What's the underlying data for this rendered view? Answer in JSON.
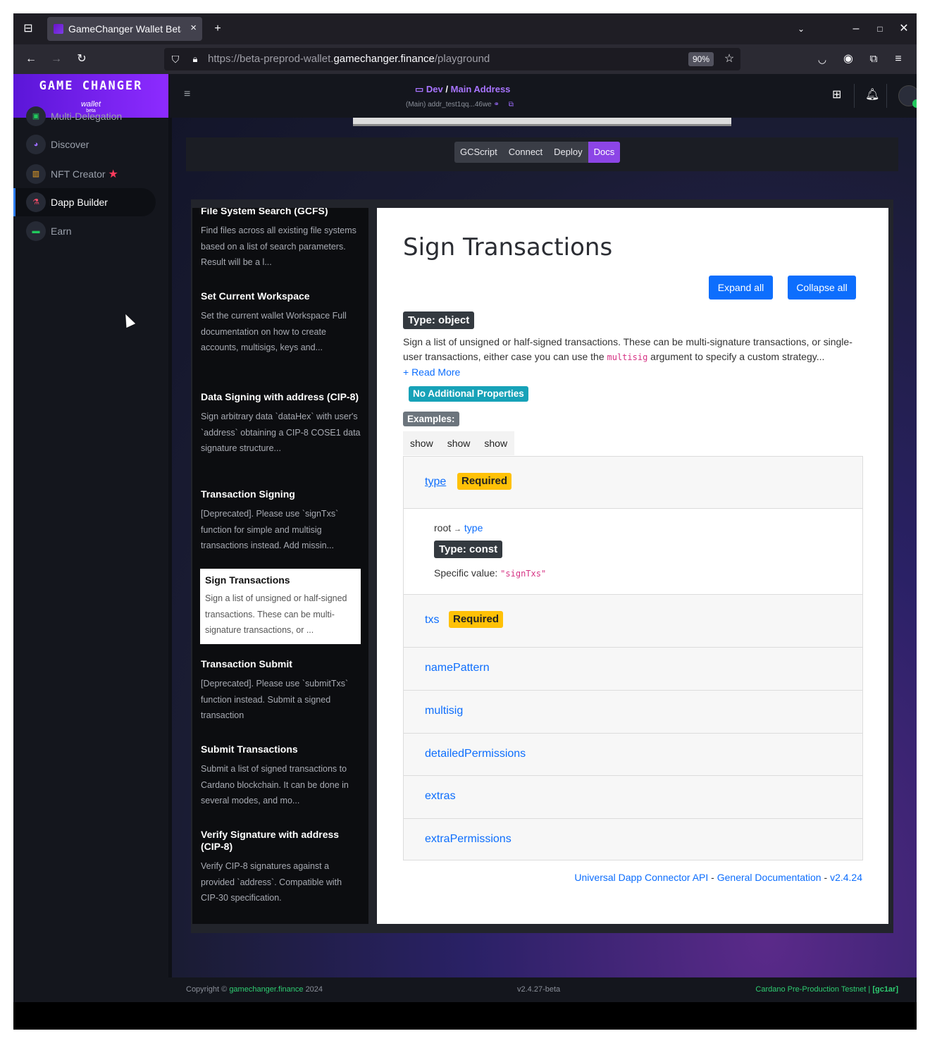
{
  "browser": {
    "tab_title": "GameChanger Wallet Beta",
    "tab_close": "×",
    "new_tab": "+",
    "url_prefix": "https://beta-preprod-wallet.",
    "url_domain": "gamechanger.finance",
    "url_path": "/playground",
    "zoom": "90%"
  },
  "app": {
    "logo_big": "GAME CHANGER",
    "logo_small": "wallet",
    "logo_beta": "beta",
    "breadcrumb_root": "Dev",
    "breadcrumb_sep": "/",
    "breadcrumb_current": "Main Address",
    "address": "(Main) addr_test1qq...46we"
  },
  "sidebar": {
    "items": [
      {
        "label": "Multi-Delegation",
        "icon": "delegation-icon",
        "icon_color": "#21c95d"
      },
      {
        "label": "Discover",
        "icon": "compass-icon",
        "icon_color": "#9d6cff"
      },
      {
        "label": "NFT Creator",
        "icon": "factory-icon",
        "icon_color": "#f5a623",
        "star": "★"
      },
      {
        "label": "Dapp Builder",
        "icon": "flask-icon",
        "icon_color": "#ff4d6a"
      },
      {
        "label": "Earn",
        "icon": "cash-icon",
        "icon_color": "#21c95d"
      }
    ]
  },
  "playground": {
    "tabs": [
      "GCScript",
      "Connect",
      "Deploy",
      "Docs"
    ],
    "active_tab": "Docs"
  },
  "doc_list": [
    {
      "title": "File System Search (GCFS)",
      "desc": "Find files across all existing file systems based on a list of search parameters. Result will be a l..."
    },
    {
      "title": "Set Current Workspace",
      "desc": "Set the current wallet Workspace Full documentation on how to create accounts, multisigs, keys and..."
    },
    {
      "title": "Data Signing with address (CIP-8)",
      "desc": "Sign arbitrary data `dataHex` with user's `address` obtaining a CIP-8 COSE1 data signature structure..."
    },
    {
      "title": "Transaction Signing",
      "desc": "[Deprecated]. Please use `signTxs` function for simple and multisig transactions instead. Add missin..."
    },
    {
      "title": "Sign Transactions",
      "desc": "Sign a list of unsigned or half-signed transactions. These can be multi-signature transactions, or ..."
    },
    {
      "title": "Transaction Submit",
      "desc": "[Deprecated]. Please use `submitTxs` function instead. Submit a signed transaction"
    },
    {
      "title": "Submit Transactions",
      "desc": "Submit a list of signed transactions to Cardano blockchain. It can be done in several modes, and mo..."
    },
    {
      "title": "Verify Signature with address (CIP-8)",
      "desc": "Verify CIP-8 signatures against a provided `address`. Compatible with CIP-30 specification."
    }
  ],
  "doc": {
    "title": "Sign Transactions",
    "expand_all": "Expand all",
    "collapse_all": "Collapse all",
    "type_badge": "Type: object",
    "description_pre": "Sign a list of unsigned or half-signed transactions. These can be multi-signature transactions, or single-user transactions, either case you can use the ",
    "description_code": "multisig",
    "description_post": " argument to specify a custom strategy...",
    "read_more": "+ Read More",
    "no_additional": "No Additional Properties",
    "examples_label": "Examples:",
    "show_tabs": [
      "show",
      "show",
      "show"
    ],
    "properties": [
      {
        "name": "type",
        "required": "Required"
      },
      {
        "name": "txs",
        "required": "Required"
      },
      {
        "name": "namePattern"
      },
      {
        "name": "multisig"
      },
      {
        "name": "detailedPermissions"
      },
      {
        "name": "extras"
      },
      {
        "name": "extraPermissions"
      }
    ],
    "type_detail": {
      "path_root": "root",
      "path_arrow": "→",
      "path_link": "type",
      "type_const": "Type: const",
      "specific_label": "Specific value:",
      "specific_value": "\"signTxs\""
    },
    "footer_link1": "Universal Dapp Connector API",
    "footer_sep": "-",
    "footer_link2": "General Documentation",
    "footer_version": "v2.4.24"
  },
  "footer": {
    "copyright_pre": "Copyright ©",
    "copyright_link": "gamechanger.finance",
    "copyright_year": "2024",
    "version": "v2.4.27-beta",
    "network": "Cardano Pre-Production Testnet |",
    "network_id": "[gc1ar]"
  }
}
